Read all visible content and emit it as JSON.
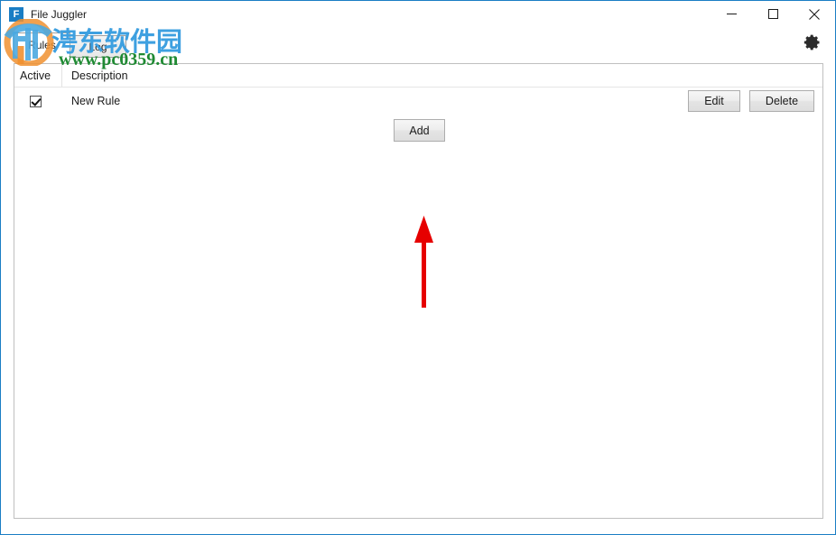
{
  "window": {
    "title": "File Juggler",
    "icon_letter": "F",
    "icon_name": "app-icon-file-juggler",
    "border_color": "#1a7dc4",
    "controls": {
      "minimize": "—",
      "maximize": "☐",
      "close": "✕"
    }
  },
  "tabs": [
    {
      "label": "Rules",
      "selected": true
    },
    {
      "label": "Log",
      "selected": false
    }
  ],
  "toolbar": {
    "settings_icon": "gear-icon"
  },
  "table": {
    "columns": [
      "Active",
      "Description"
    ],
    "rows": [
      {
        "active": true,
        "description": "New Rule",
        "edit_label": "Edit",
        "delete_label": "Delete"
      }
    ]
  },
  "actions": {
    "add_label": "Add"
  },
  "annotation": {
    "type": "arrow",
    "direction": "up",
    "color": "#e60000",
    "points_to": "Add"
  },
  "watermark": {
    "chinese_text": "涄东软件园",
    "url": "www.pc0359.cn",
    "chinese_color": "#3ea0e0",
    "url_color": "#1f8a33"
  }
}
